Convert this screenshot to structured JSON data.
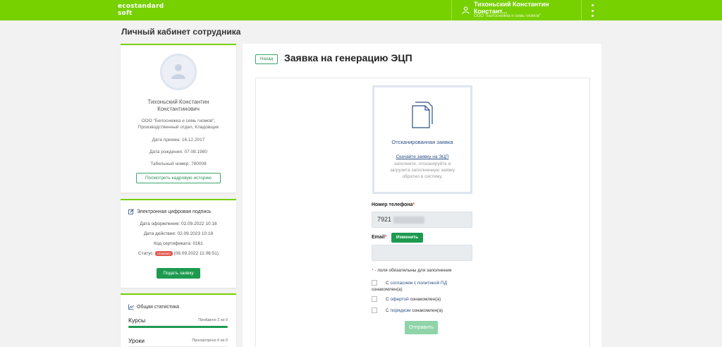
{
  "colors": {
    "brand": "#77d000",
    "button": "#1d9a4f",
    "badge": "#e2574c",
    "link": "#2b4f85"
  },
  "header": {
    "logo_line1": "ecostandard",
    "logo_line2": "soft",
    "user_name_line1": "Тихоньский Константин",
    "user_name_line2": "Констант...",
    "user_org": "ООО \"Белоснежка и семь гномов\"",
    "user_icon": "user-icon",
    "menu_icon": "more-vertical-icon"
  },
  "page": {
    "title": "Личный кабинет сотрудника"
  },
  "profile": {
    "avatar_icon": "avatar-placeholder-icon",
    "name_line1": "Тихоньский Константин",
    "name_line2": "Константинович",
    "org_line1": "ООО \"Белоснежка и семь гномов\",",
    "org_line2": "Производственный отдел, Кладовщик",
    "hire_date": "Дата приема: 16.12.2017",
    "birth_date": "Дата рождения: 07.08.1980",
    "tab_number": "Табельный номер: 780008",
    "history_button": "Посмотреть кадровую историю"
  },
  "signature": {
    "icon": "edit-signature-icon",
    "title": "Электронная цифровая подпись",
    "issue_date": "Дата оформления: 02.09.2022 10:18",
    "valid_date": "Дата действия: 02.09.2023 10:18",
    "cert_code": "Код сертификата: 0161",
    "status_label": "Статус:",
    "status_badge": "отказано",
    "status_date": "(08.09.2022 11:06:51)",
    "apply_button": "Подать заявку"
  },
  "stats": {
    "icon": "bar-chart-icon",
    "title": "Общая статистика",
    "rows": [
      {
        "label": "Курсы",
        "value": "Пройдено 2 из 0",
        "progress": 1.0
      },
      {
        "label": "Уроки",
        "value": "Просмотрено 0 из 0",
        "progress": 0.0
      }
    ]
  },
  "form": {
    "back_button": "Назад",
    "title": "Заявка на генерацию ЭЦП",
    "scan": {
      "icon": "document-icon",
      "title": "Отсканированная заявка",
      "link": "Скачайте заявку на ЭЦП",
      "desc_line1": "заполните, отсканируйте и",
      "desc_line2": "загрузите заполненную заявку",
      "desc_line3": "обратно в систему."
    },
    "phone_label": "Номер телефона",
    "phone_value": "7921",
    "email_label": "Email",
    "required_mark": "*",
    "change_button": "Изменить",
    "required_note": "- поля обязательны для заполнения",
    "consent_pd_prefix": "С ",
    "consent_pd_link": "согласием с политикой ПД",
    "consent_pd_suffix": "ознакомлен(а)",
    "offer_prefix": "С ",
    "offer_link": "офертой",
    "offer_suffix": " ознакомлен(а)",
    "order_prefix": "С ",
    "order_link": "порядком",
    "order_suffix": " ознакомлен(а)",
    "submit_button": "Отправить"
  }
}
